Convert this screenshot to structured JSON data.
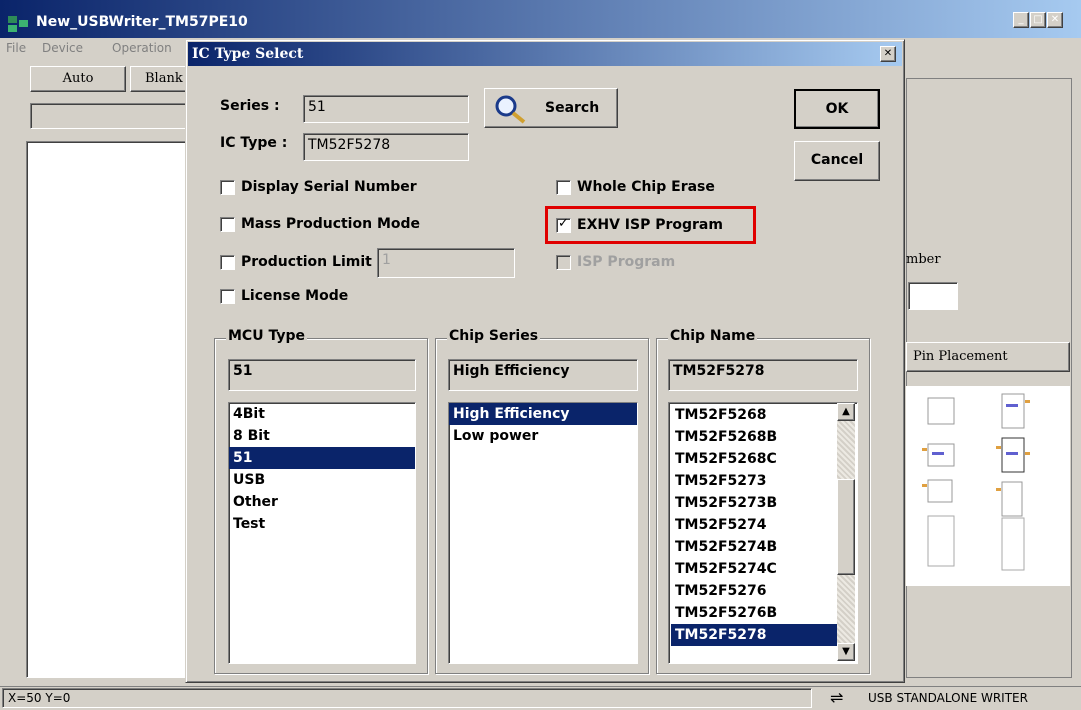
{
  "app": {
    "title": "New_USBWriter_TM57PE10",
    "menu": [
      "File",
      "Device",
      "Operation"
    ],
    "toolbar": {
      "auto_label": "Auto",
      "blank_label": "Blank"
    },
    "right_panel": {
      "number_label": "mber",
      "pin_placement_label": "Pin Placement"
    },
    "status": {
      "coords": "X=50 Y=0",
      "device_text": "USB STANDALONE WRITER"
    }
  },
  "dialog": {
    "title": "IC Type Select",
    "series_label": "Series :",
    "series_value": "51",
    "search_label": "Search",
    "ic_type_label": "IC Type :",
    "ic_type_value": "TM52F5278",
    "ok_label": "OK",
    "cancel_label": "Cancel",
    "options": {
      "display_serial_number": {
        "label": "Display Serial Number",
        "checked": false
      },
      "mass_production_mode": {
        "label": "Mass Production Mode",
        "checked": false
      },
      "production_limit": {
        "label": "Production Limit :",
        "checked": false,
        "value": "1"
      },
      "license_mode": {
        "label": "License Mode",
        "checked": false
      },
      "whole_chip_erase": {
        "label": "Whole Chip Erase",
        "checked": false
      },
      "exhv_isp_program": {
        "label": "EXHV ISP Program",
        "checked": true,
        "highlight_color": "#e00000"
      },
      "isp_program": {
        "label": "ISP Program",
        "checked": false,
        "disabled": true
      }
    },
    "mcu_type": {
      "caption": "MCU Type",
      "value": "51",
      "items": [
        "4Bit",
        "8 Bit",
        "51",
        "USB",
        "Other",
        "Test"
      ],
      "selected_index": 2
    },
    "chip_series": {
      "caption": "Chip Series",
      "value": "High Efficiency",
      "items": [
        "High Efficiency",
        "Low power"
      ],
      "selected_index": 0
    },
    "chip_name": {
      "caption": "Chip Name",
      "value": "TM52F5278",
      "items": [
        "TM52F5268",
        "TM52F5268B",
        "TM52F5268C",
        "TM52F5273",
        "TM52F5273B",
        "TM52F5274",
        "TM52F5274B",
        "TM52F5274C",
        "TM52F5276",
        "TM52F5276B",
        "TM52F5278"
      ],
      "selected_index": 10
    }
  },
  "colors": {
    "titlebar": "#0a246a",
    "selection": "#0a246a",
    "face": "#d4d0c8"
  }
}
